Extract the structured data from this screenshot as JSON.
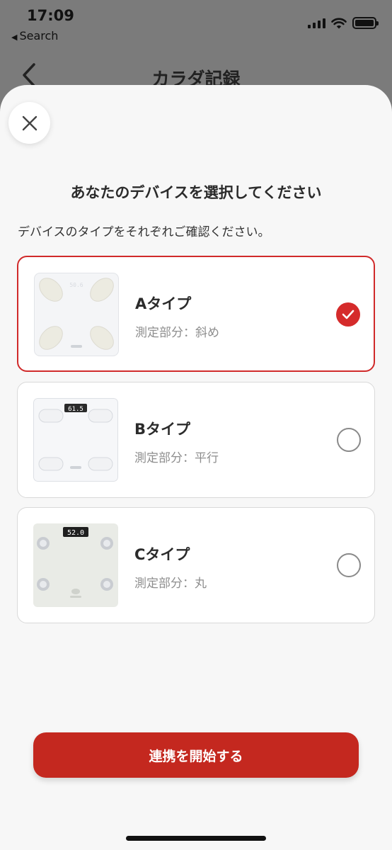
{
  "status_bar": {
    "time": "17:09",
    "back_label": "Search"
  },
  "header": {
    "title": "カラダ記録"
  },
  "sheet": {
    "title": "あなたのデバイスを選択してください",
    "description": "デバイスのタイプをそれぞれご確認ください。",
    "start_label": "連携を開始する"
  },
  "devices": [
    {
      "name": "Aタイプ",
      "measure": "測定部分：斜め",
      "selected": true,
      "display": "50.6"
    },
    {
      "name": "Bタイプ",
      "measure": "測定部分：平行",
      "selected": false,
      "display": "61.5"
    },
    {
      "name": "Cタイプ",
      "measure": "測定部分：丸",
      "selected": false,
      "display": "52.0"
    }
  ],
  "colors": {
    "accent": "#c4281f",
    "selected_border": "#d02a2a",
    "check": "#d52b2b"
  }
}
